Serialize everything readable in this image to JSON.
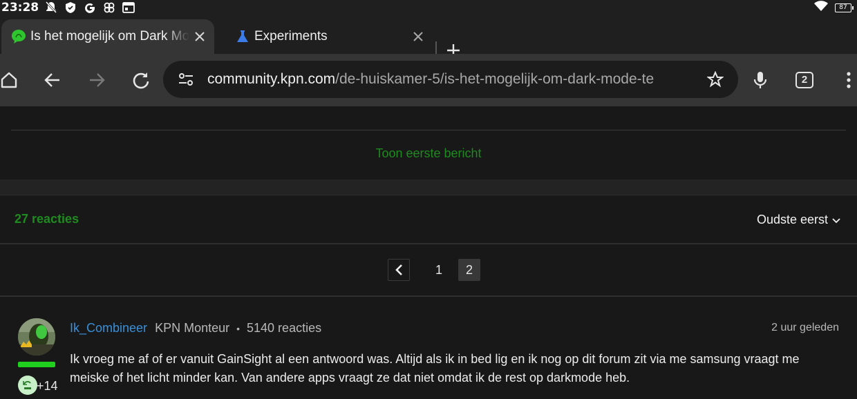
{
  "status_bar": {
    "time": "23:28",
    "battery": "87",
    "icons": [
      "notifications-off-icon",
      "shield-icon",
      "google-icon",
      "pinwheel-icon",
      "calendar-icon",
      "wifi-icon",
      "battery-icon"
    ]
  },
  "tabs": [
    {
      "title": "Is het mogelijk om Dark Mode te",
      "favicon": "kpn-community-icon",
      "active": true
    },
    {
      "title": "Experiments",
      "favicon": "flask-icon",
      "active": false
    }
  ],
  "toolbar": {
    "url_host": "community.kpn.com",
    "url_path": "/de-huiskamer-5/is-het-mogelijk-om-dark-mode-te",
    "tab_count": "2"
  },
  "page": {
    "show_first_post": "Toon eerste bericht",
    "replies_count": "27 reacties",
    "sort_label": "Oudste eerst",
    "pagination": {
      "pages": [
        "1",
        "2"
      ],
      "current": "2"
    },
    "post": {
      "author": "Ik_Combineer",
      "role": "KPN Monteur",
      "separator": "•",
      "reply_count": "5140 reacties",
      "time": "2 uur geleden",
      "badge_extra": "+14",
      "text": "Ik vroeg me af of er vanuit GainSight al een antwoord was. Altijd als ik in bed lig en ik nog op dit forum zit via me samsung vraagt me meiske of het licht minder kan. Van andere apps vraagt ze dat niet omdat ik de rest op darkmode heb."
    }
  },
  "colors": {
    "accent_green": "#1f8a1f",
    "link_blue": "#3a8fd8",
    "rank_green": "#1fd01f",
    "background": "#181818",
    "toolbar": "#353535"
  }
}
